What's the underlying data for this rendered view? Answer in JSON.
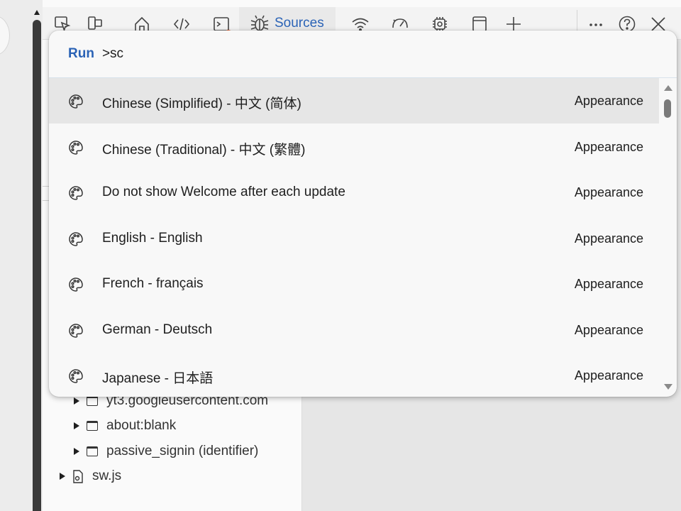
{
  "toolbar": {
    "icons": [
      "inspect-element-icon",
      "device-emulation-icon",
      "welcome-icon",
      "elements-icon",
      "console-icon",
      "sources-bug-icon",
      "network-icon",
      "performance-icon",
      "memory-icon",
      "application-icon",
      "more-tools-icon",
      "more-options-icon",
      "help-icon",
      "close-icon"
    ],
    "active_tab_label": "Sources",
    "accent_color": "#2b63b6",
    "badge_color": "#e05a2b"
  },
  "sidebar": {
    "tree": [
      {
        "label": "yt3.googleusercontent.com",
        "type": "frame"
      },
      {
        "label": "about:blank",
        "type": "frame"
      },
      {
        "label": "passive_signin (identifier)",
        "type": "frame"
      },
      {
        "label": "sw.js",
        "type": "file"
      }
    ]
  },
  "command_palette": {
    "prompt_label": "Run",
    "query": ">sc",
    "results": [
      {
        "title": "Chinese (Simplified) - 中文 (简体)",
        "category": "Appearance",
        "icon": "palette-icon",
        "selected": true
      },
      {
        "title": "Chinese (Traditional) - 中文 (繁體)",
        "category": "Appearance",
        "icon": "palette-icon",
        "selected": false
      },
      {
        "title": "Do not show Welcome after each update",
        "category": "Appearance",
        "icon": "palette-icon",
        "selected": false
      },
      {
        "title": "English - English",
        "category": "Appearance",
        "icon": "palette-icon",
        "selected": false
      },
      {
        "title": "French - français",
        "category": "Appearance",
        "icon": "palette-icon",
        "selected": false
      },
      {
        "title": "German - Deutsch",
        "category": "Appearance",
        "icon": "palette-icon",
        "selected": false
      },
      {
        "title": "Japanese - 日本語",
        "category": "Appearance",
        "icon": "palette-icon",
        "selected": false
      }
    ]
  }
}
